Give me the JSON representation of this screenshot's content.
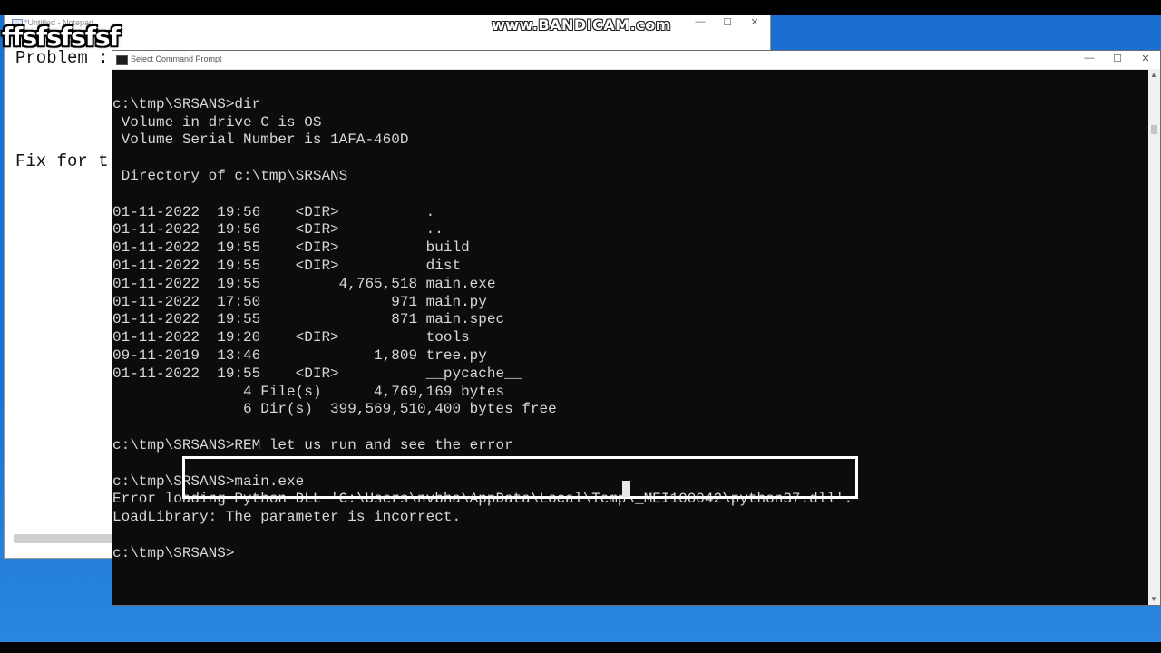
{
  "overlay_label": "ffsfsfsfsf",
  "watermark": "www.BANDICAM.com",
  "notepad": {
    "title": "*Untitled - Notepad",
    "lines": [
      "Problem :",
      "Fix for t"
    ],
    "controls": {
      "minimize": "—",
      "maximize": "☐",
      "close": "✕"
    }
  },
  "cmd": {
    "title": "Select Command Prompt",
    "controls": {
      "minimize": "—",
      "maximize": "☐",
      "close": "✕"
    },
    "lines": [
      "",
      "c:\\tmp\\SRSANS>dir",
      " Volume in drive C is OS",
      " Volume Serial Number is 1AFA-460D",
      "",
      " Directory of c:\\tmp\\SRSANS",
      "",
      "01-11-2022  19:56    <DIR>          .",
      "01-11-2022  19:56    <DIR>          ..",
      "01-11-2022  19:55    <DIR>          build",
      "01-11-2022  19:55    <DIR>          dist",
      "01-11-2022  19:55         4,765,518 main.exe",
      "01-11-2022  17:50               971 main.py",
      "01-11-2022  19:55               871 main.spec",
      "01-11-2022  19:20    <DIR>          tools",
      "09-11-2019  13:46             1,809 tree.py",
      "01-11-2022  19:55    <DIR>          __pycache__",
      "               4 File(s)      4,769,169 bytes",
      "               6 Dir(s)  399,569,510,400 bytes free",
      "",
      "c:\\tmp\\SRSANS>REM let us run and see the error",
      "",
      "c:\\tmp\\SRSANS>main.exe",
      "Error loading Python DLL 'C:\\Users\\nvbha\\AppData\\Local\\Temp\\_MEI100042\\python37.dll'.",
      "LoadLibrary: The parameter is incorrect.",
      "",
      "c:\\tmp\\SRSANS>"
    ]
  },
  "colors": {
    "console_bg": "#0c0c0c",
    "console_fg": "#d8d8d8",
    "desktop": "#1a6fd0"
  }
}
